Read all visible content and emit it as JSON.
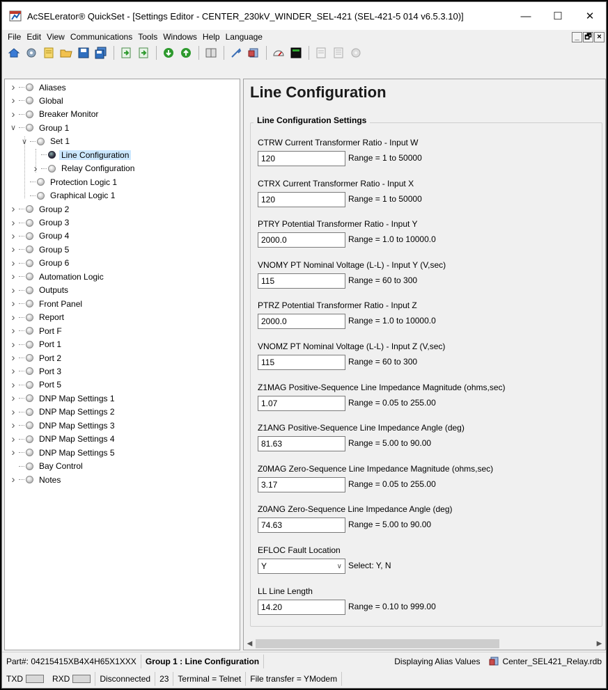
{
  "window": {
    "title": "AcSELerator® QuickSet - [Settings Editor - CENTER_230kV_WINDER_SEL-421 (SEL-421-5 014 v6.5.3.10)]",
    "minimize": "—",
    "maximize": "☐",
    "close": "✕"
  },
  "menu": {
    "items": [
      "File",
      "Edit",
      "View",
      "Communications",
      "Tools",
      "Windows",
      "Help",
      "Language"
    ],
    "mdi": [
      "_",
      "🗗",
      "×"
    ]
  },
  "toolbar": {
    "icons": [
      "home-icon",
      "settings-gear-icon",
      "new-document-icon",
      "open-folder-icon",
      "save-icon",
      "save-all-icon",
      "import-icon",
      "export-icon",
      "read-icon",
      "send-icon",
      "compare-icon",
      "tools-icon",
      "database-icon",
      "meter-icon",
      "terminal-icon",
      "report-icon",
      "list-icon",
      "gear-disabled-icon"
    ]
  },
  "tree": {
    "items": [
      {
        "label": "Aliases",
        "level": 0,
        "expand": ">"
      },
      {
        "label": "Global",
        "level": 0,
        "expand": ">"
      },
      {
        "label": "Breaker Monitor",
        "level": 0,
        "expand": ">"
      },
      {
        "label": "Group 1",
        "level": 0,
        "expand": "v"
      },
      {
        "label": "Set 1",
        "level": 1,
        "expand": "v"
      },
      {
        "label": "Line Configuration",
        "level": 2,
        "expand": "",
        "selected": true
      },
      {
        "label": "Relay Configuration",
        "level": 2,
        "expand": ">"
      },
      {
        "label": "Protection Logic 1",
        "level": 1,
        "expand": ""
      },
      {
        "label": "Graphical Logic 1",
        "level": 1,
        "expand": ""
      },
      {
        "label": "Group 2",
        "level": 0,
        "expand": ">"
      },
      {
        "label": "Group 3",
        "level": 0,
        "expand": ">"
      },
      {
        "label": "Group 4",
        "level": 0,
        "expand": ">"
      },
      {
        "label": "Group 5",
        "level": 0,
        "expand": ">"
      },
      {
        "label": "Group 6",
        "level": 0,
        "expand": ">"
      },
      {
        "label": "Automation Logic",
        "level": 0,
        "expand": ">"
      },
      {
        "label": "Outputs",
        "level": 0,
        "expand": ">"
      },
      {
        "label": "Front Panel",
        "level": 0,
        "expand": ">"
      },
      {
        "label": "Report",
        "level": 0,
        "expand": ">"
      },
      {
        "label": "Port F",
        "level": 0,
        "expand": ">"
      },
      {
        "label": "Port 1",
        "level": 0,
        "expand": ">"
      },
      {
        "label": "Port 2",
        "level": 0,
        "expand": ">"
      },
      {
        "label": "Port 3",
        "level": 0,
        "expand": ">"
      },
      {
        "label": "Port 5",
        "level": 0,
        "expand": ">"
      },
      {
        "label": "DNP Map Settings 1",
        "level": 0,
        "expand": ">"
      },
      {
        "label": "DNP Map Settings 2",
        "level": 0,
        "expand": ">"
      },
      {
        "label": "DNP Map Settings 3",
        "level": 0,
        "expand": ">"
      },
      {
        "label": "DNP Map Settings 4",
        "level": 0,
        "expand": ">"
      },
      {
        "label": "DNP Map Settings 5",
        "level": 0,
        "expand": ">"
      },
      {
        "label": "Bay Control",
        "level": 0,
        "expand": ""
      },
      {
        "label": "Notes",
        "level": 0,
        "expand": ">"
      }
    ]
  },
  "editor": {
    "title": "Line Configuration",
    "group_title": "Line Configuration Settings",
    "settings": [
      {
        "label": "CTRW  Current Transformer Ratio - Input W",
        "value": "120",
        "range": "Range = 1 to 50000",
        "type": "text"
      },
      {
        "label": "CTRX  Current Transformer Ratio - Input X",
        "value": "120",
        "range": "Range = 1 to 50000",
        "type": "text"
      },
      {
        "label": "PTRY  Potential Transformer Ratio - Input Y",
        "value": "2000.0",
        "range": "Range = 1.0 to 10000.0",
        "type": "text"
      },
      {
        "label": "VNOMY  PT Nominal Voltage (L-L) - Input Y (V,sec)",
        "value": "115",
        "range": "Range = 60 to 300",
        "type": "text"
      },
      {
        "label": "PTRZ  Potential Transformer Ratio - Input Z",
        "value": "2000.0",
        "range": "Range = 1.0 to 10000.0",
        "type": "text"
      },
      {
        "label": "VNOMZ  PT Nominal Voltage (L-L) - Input Z (V,sec)",
        "value": "115",
        "range": "Range = 60 to 300",
        "type": "text"
      },
      {
        "label": "Z1MAG  Positive-Sequence Line Impedance Magnitude (ohms,sec)",
        "value": "1.07",
        "range": "Range = 0.05 to 255.00",
        "type": "text"
      },
      {
        "label": "Z1ANG  Positive-Sequence Line Impedance Angle (deg)",
        "value": "81.63",
        "range": "Range = 5.00 to 90.00",
        "type": "text"
      },
      {
        "label": "Z0MAG  Zero-Sequence Line Impedance Magnitude (ohms,sec)",
        "value": "3.17",
        "range": "Range = 0.05 to 255.00",
        "type": "text"
      },
      {
        "label": "Z0ANG  Zero-Sequence Line Impedance Angle (deg)",
        "value": "74.63",
        "range": "Range = 5.00 to 90.00",
        "type": "text"
      },
      {
        "label": "EFLOC  Fault Location",
        "value": "Y",
        "range": "Select: Y, N",
        "type": "select"
      },
      {
        "label": "LL  Line Length",
        "value": "14.20",
        "range": "Range = 0.10 to 999.00",
        "type": "text"
      }
    ]
  },
  "statusbar": {
    "part": "Part#: 04215415XB4X4H65X1XXX",
    "group": "Group 1 : Line Configuration",
    "alias": "Displaying Alias Values",
    "file": "Center_SEL421_Relay.rdb",
    "txd": "TXD",
    "rxd": "RXD",
    "connection": "Disconnected",
    "count": "23",
    "terminal": "Terminal = Telnet",
    "transfer": "File transfer = YModem"
  },
  "colors": {
    "selection": "#cce8ff",
    "window_bg": "#f0f0f0",
    "green_button": "#2e9a2e"
  }
}
